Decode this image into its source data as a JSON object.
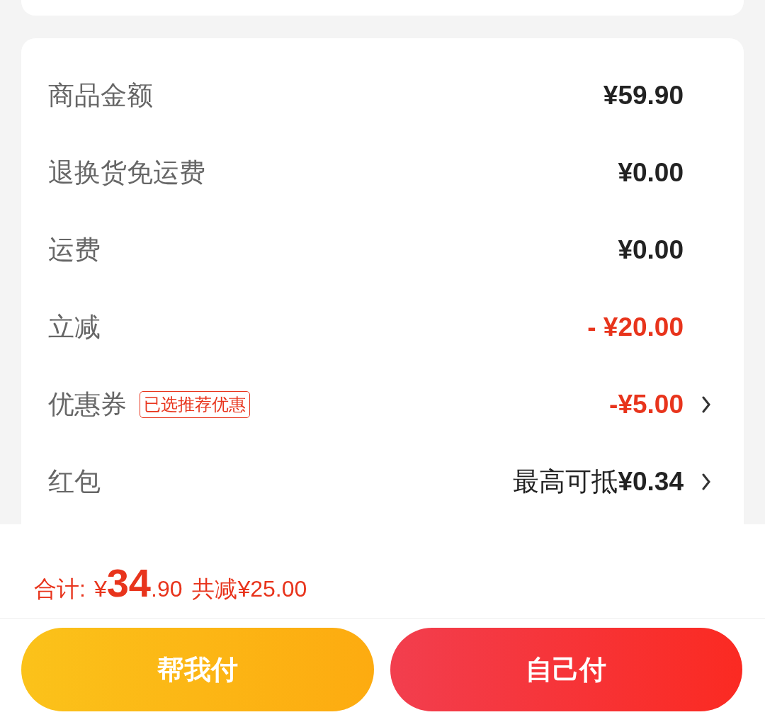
{
  "rows": [
    {
      "label": "商品金额",
      "value": "¥59.90",
      "discount": false,
      "has_arrow": false
    },
    {
      "label": "退换货免运费",
      "value": "¥0.00",
      "discount": false,
      "has_arrow": false
    },
    {
      "label": "运费",
      "value": "¥0.00",
      "discount": false,
      "has_arrow": false
    },
    {
      "label": "立减",
      "value": "- ¥20.00",
      "discount": true,
      "has_arrow": false
    },
    {
      "label": "优惠券",
      "tag": "已选推荐优惠",
      "value": "-¥5.00",
      "discount": true,
      "has_arrow": true
    },
    {
      "label": "红包",
      "value_prefix": "最高可抵",
      "value": "¥0.34",
      "discount": false,
      "has_arrow": true
    }
  ],
  "total": {
    "label": "合计:",
    "currency": "¥",
    "integer": "34",
    "decimal": ".90",
    "savings": "共减¥25.00"
  },
  "buttons": [
    {
      "label": "帮我付",
      "kind": "friend"
    },
    {
      "label": "自己付",
      "kind": "self"
    }
  ]
}
